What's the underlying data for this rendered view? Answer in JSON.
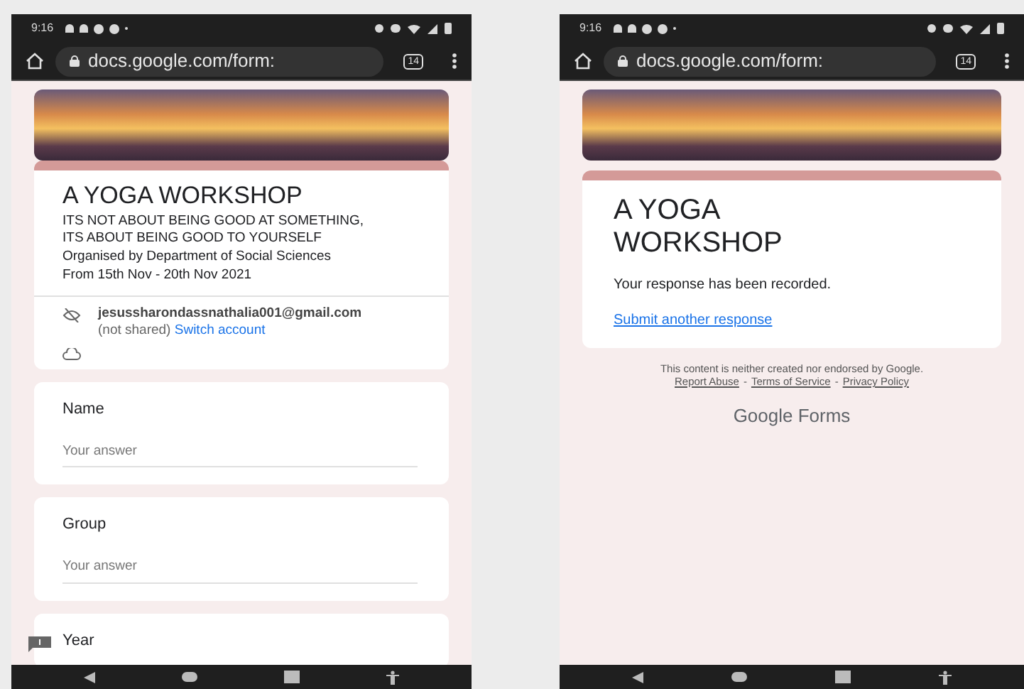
{
  "screens": [
    {
      "kind": "form",
      "status_time": "9:16",
      "tab_count": "14",
      "url": "docs.google.com/form:",
      "header": {
        "title": "A YOGA WORKSHOP",
        "description": [
          "ITS NOT ABOUT BEING GOOD AT SOMETHING, ITS ABOUT BEING GOOD TO YOURSELF",
          "Organised by Department of Social Sciences",
          "From 15th Nov - 20th Nov 2021"
        ],
        "email": "jesussharondassnathalia001@gmail.com",
        "not_shared": "(not shared)",
        "switch_account": "Switch account"
      },
      "questions": [
        {
          "label": "Name",
          "placeholder": "Your answer"
        },
        {
          "label": "Group",
          "placeholder": "Your answer"
        },
        {
          "label": "Year"
        }
      ]
    },
    {
      "kind": "confirmation",
      "status_time": "9:16",
      "tab_count": "14",
      "url": "docs.google.com/form:",
      "header": {
        "title": "A YOGA WORKSHOP",
        "message": "Your response has been recorded.",
        "link": "Submit another response"
      },
      "footer": {
        "disclaimer": "This content is neither created nor endorsed by Google.",
        "links": [
          "Report Abuse",
          "Terms of Service",
          "Privacy Policy"
        ],
        "separator": "-",
        "brand": "Google Forms"
      }
    }
  ]
}
